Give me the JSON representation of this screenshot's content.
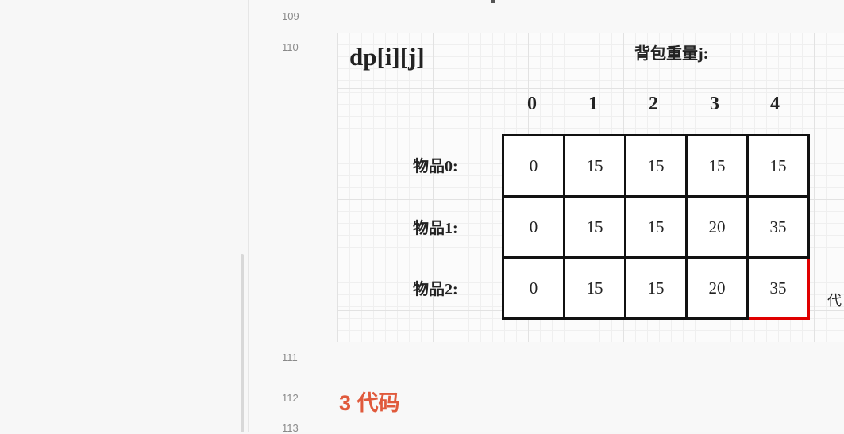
{
  "line_numbers": [
    "109",
    "110",
    "111",
    "112",
    "113"
  ],
  "figure": {
    "title": "dp[i][j]",
    "weight_label": "背包重量j:",
    "columns": [
      "0",
      "1",
      "2",
      "3",
      "4"
    ],
    "rows": [
      {
        "label": "物品0:",
        "values": [
          "0",
          "15",
          "15",
          "15",
          "15"
        ]
      },
      {
        "label": "物品1:",
        "values": [
          "0",
          "15",
          "15",
          "20",
          "35"
        ]
      },
      {
        "label": "物品2:",
        "values": [
          "0",
          "15",
          "15",
          "20",
          "35"
        ]
      }
    ],
    "highlight_color": "#e00000",
    "side_note": "代"
  },
  "heading": {
    "text": "3 代码",
    "color": "#e05a3c"
  }
}
